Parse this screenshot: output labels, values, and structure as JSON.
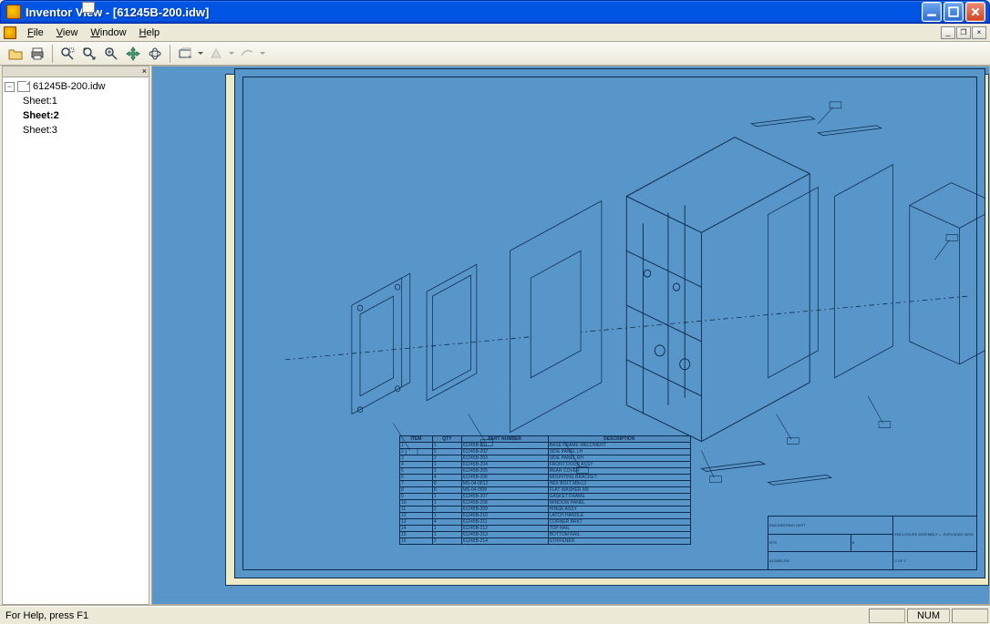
{
  "window": {
    "app_name": "Inventor View",
    "document": "[61245B-200.idw]"
  },
  "menu": {
    "file": "File",
    "view": "View",
    "window": "Window",
    "help": "Help"
  },
  "toolbar": {
    "open": "Open",
    "print": "Print",
    "zoom_window": "Zoom Window",
    "zoom_all": "Zoom All",
    "zoom": "Zoom",
    "pan": "Pan",
    "rotate": "Rotate",
    "look_at": "Look At",
    "measure": "Measure",
    "display_mode": "Display Mode"
  },
  "browser": {
    "root": "61245B-200.idw",
    "sheets": [
      {
        "label": "Sheet:1",
        "active": false
      },
      {
        "label": "Sheet:2",
        "active": true
      },
      {
        "label": "Sheet:3",
        "active": false
      }
    ]
  },
  "status": {
    "help": "For Help, press F1",
    "num": "NUM"
  },
  "parts_list": {
    "headers": [
      "ITEM",
      "QTY",
      "PART NUMBER",
      "DESCRIPTION"
    ],
    "rows": [
      [
        "1",
        "1",
        "61245B-201",
        "BASE FRAME WELDMENT"
      ],
      [
        "2",
        "2",
        "61245B-202",
        "SIDE PANEL LH"
      ],
      [
        "3",
        "2",
        "61245B-203",
        "SIDE PANEL RH"
      ],
      [
        "4",
        "1",
        "61245B-204",
        "FRONT DOOR ASSY"
      ],
      [
        "5",
        "1",
        "61245B-205",
        "REAR COVER"
      ],
      [
        "6",
        "4",
        "61245B-206",
        "MOUNTING BRACKET"
      ],
      [
        "7",
        "8",
        "MS-04-0812",
        "HEX BOLT M8x12"
      ],
      [
        "8",
        "8",
        "MS-04-08W",
        "FLAT WASHER M8"
      ],
      [
        "9",
        "1",
        "61245B-207",
        "GASKET FRAME"
      ],
      [
        "10",
        "1",
        "61245B-208",
        "WINDOW PANEL"
      ],
      [
        "11",
        "2",
        "61245B-209",
        "HINGE ASSY"
      ],
      [
        "12",
        "1",
        "61245B-210",
        "LATCH HANDLE"
      ],
      [
        "13",
        "4",
        "61245B-211",
        "CORNER BRKT"
      ],
      [
        "14",
        "1",
        "61245B-212",
        "TOP RAIL"
      ],
      [
        "15",
        "1",
        "61245B-213",
        "BOTTOM RAIL"
      ],
      [
        "16",
        "2",
        "61245B-214",
        "STIFFENER"
      ]
    ]
  },
  "title_block": {
    "company": "ENGINEERING DEPT",
    "title": "ENCLOSURE ASSEMBLY — EXPLODED VIEW",
    "dwg_no": "61245B-200",
    "sheet": "2 OF 3",
    "scale": "NTS",
    "rev": "B"
  }
}
